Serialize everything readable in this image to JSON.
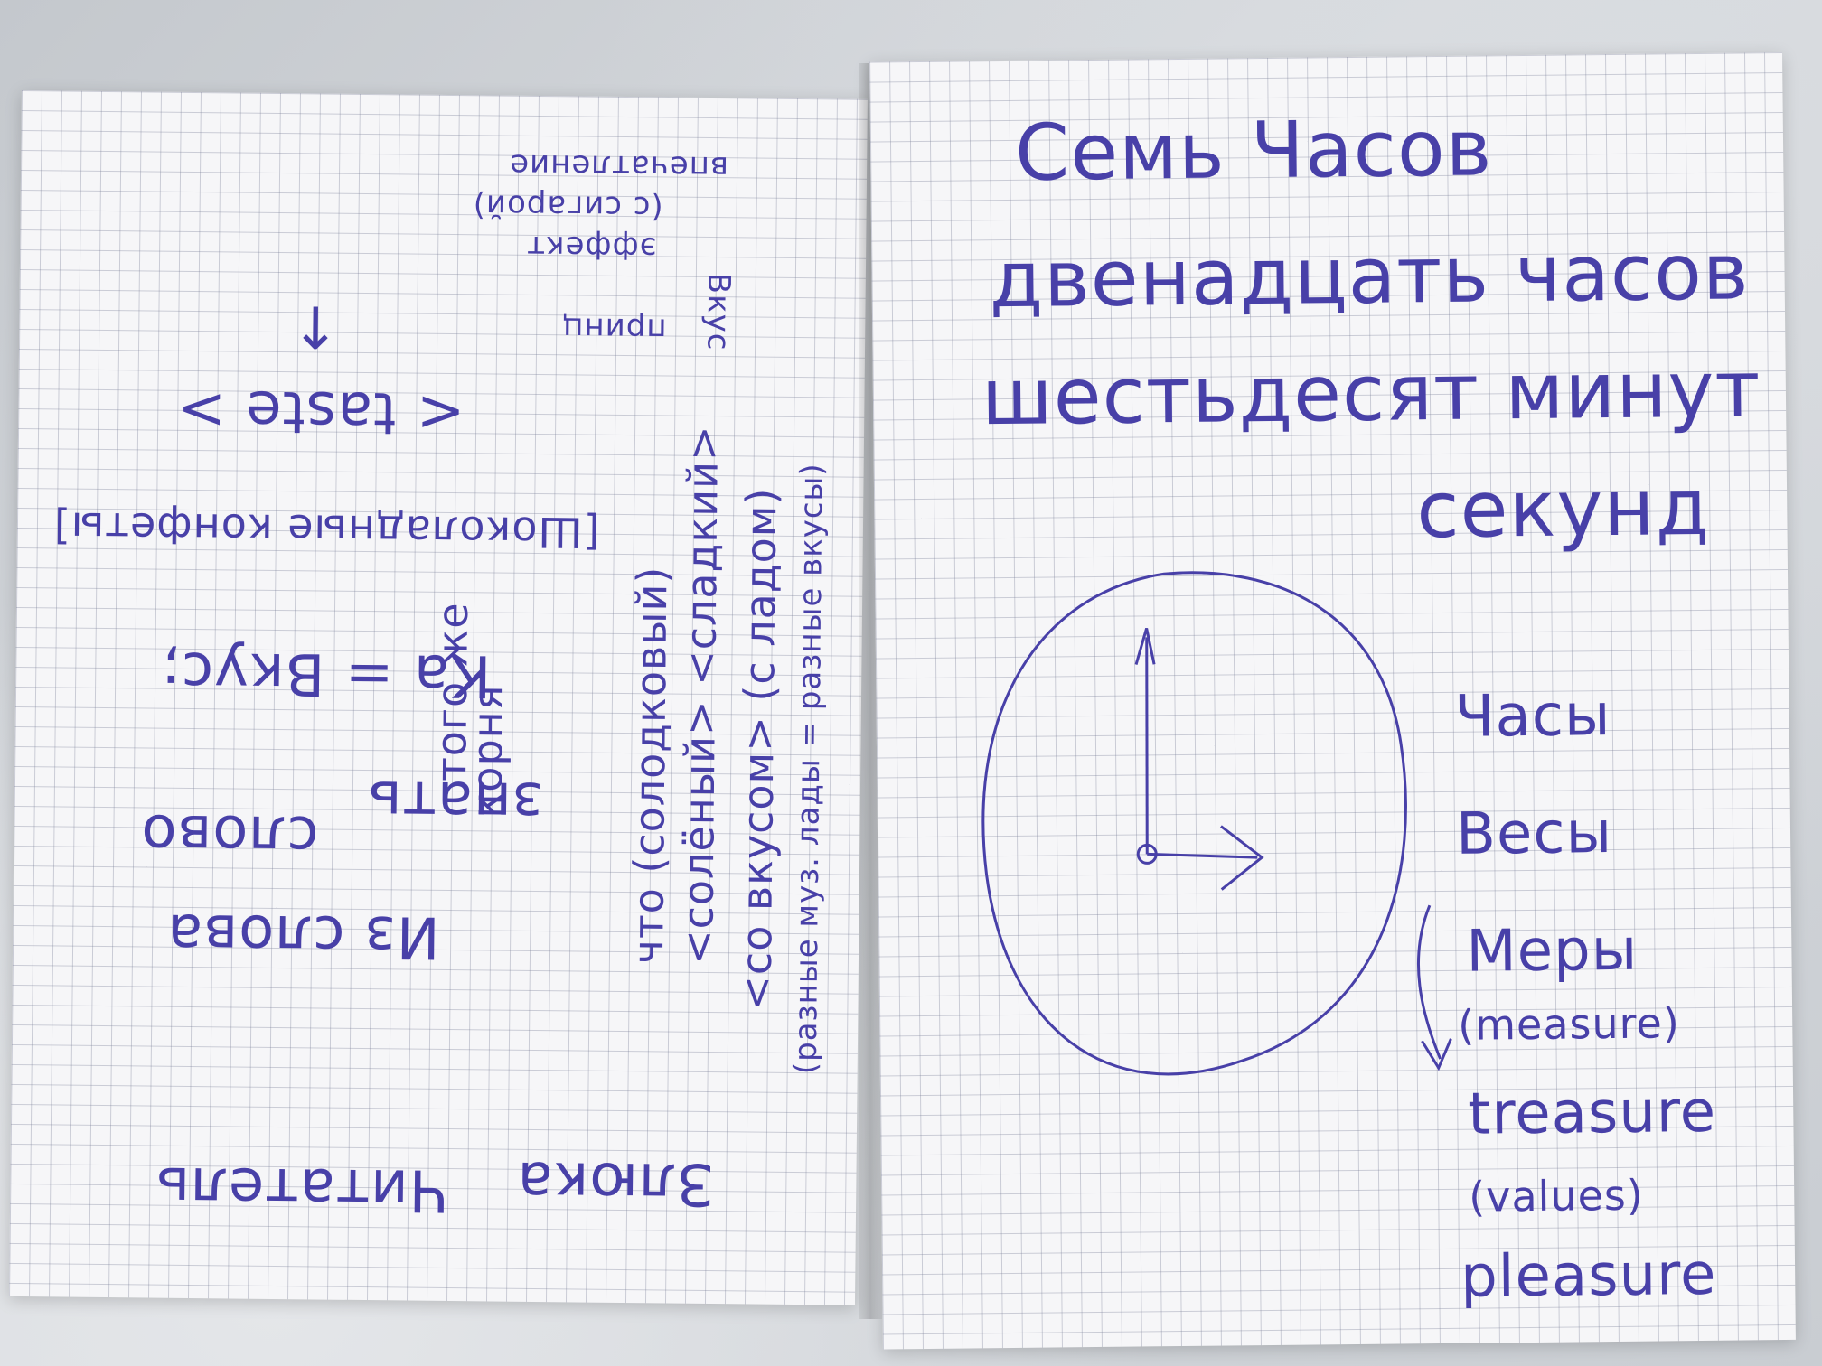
{
  "right_page": {
    "title": "Семь Часов",
    "line2": "двенадцать часов",
    "line3": "шестьдесят минут",
    "line4": "секунд",
    "word_list": [
      "Часы",
      "Весы",
      "Меры",
      "(measure)",
      "treasure",
      "(values)",
      "pleasure"
    ]
  },
  "left_page": {
    "top_word": "Злюка",
    "top_word2": "Читатель",
    "phrase1": "Из слова",
    "phrase2": "слово",
    "phrase3": "знать",
    "phrase4": "Ка = Вкус;",
    "bracket_note": "[Шоколадные конфеты]",
    "angle_note": "< taste >",
    "arrow_glyph": "↑",
    "root_note": "корня",
    "same_note": "того же",
    "line_a": "что (солодковый)",
    "line_b": "<солёный> <сладкий>",
    "line_c": "<со вкусом> (с ладом)",
    "line_d": "(разные муз. лады = разные вкусы)",
    "corner_1": "принц",
    "corner_2": "Вкус",
    "corner_3": "эффект",
    "corner_4": "(с сигарой)",
    "corner_5": "впечатление"
  },
  "colors": {
    "ink": "#4840a8",
    "paper": "#f6f6f8",
    "grid": "#787d96"
  }
}
